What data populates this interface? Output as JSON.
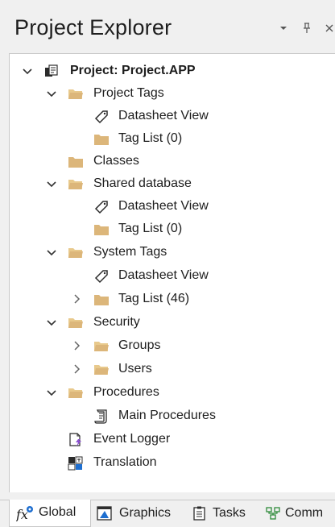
{
  "panel": {
    "title": "Project Explorer",
    "dropdown_icon": "chevron-down-icon",
    "pin_icon": "pin-icon",
    "close_icon": "close-icon"
  },
  "tree": {
    "project_label": "Project: Project.APP",
    "project_tags": "Project Tags",
    "project_tags_datasheet": "Datasheet View",
    "project_tags_taglist": "Tag List (0)",
    "classes": "Classes",
    "shared_database": "Shared database",
    "shared_datasheet": "Datasheet View",
    "shared_taglist": "Tag List (0)",
    "system_tags": "System Tags",
    "system_datasheet": "Datasheet View",
    "system_taglist": "Tag List (46)",
    "security": "Security",
    "groups": "Groups",
    "users": "Users",
    "procedures": "Procedures",
    "main_procedures": "Main Procedures",
    "event_logger": "Event Logger",
    "translation": "Translation"
  },
  "tabs": {
    "global": "Global",
    "graphics": "Graphics",
    "tasks": "Tasks",
    "comm": "Comm"
  },
  "colors": {
    "folder": "#dcb67a",
    "folder_open": "#e8c98c",
    "accent_blue": "#1f6fd0"
  }
}
